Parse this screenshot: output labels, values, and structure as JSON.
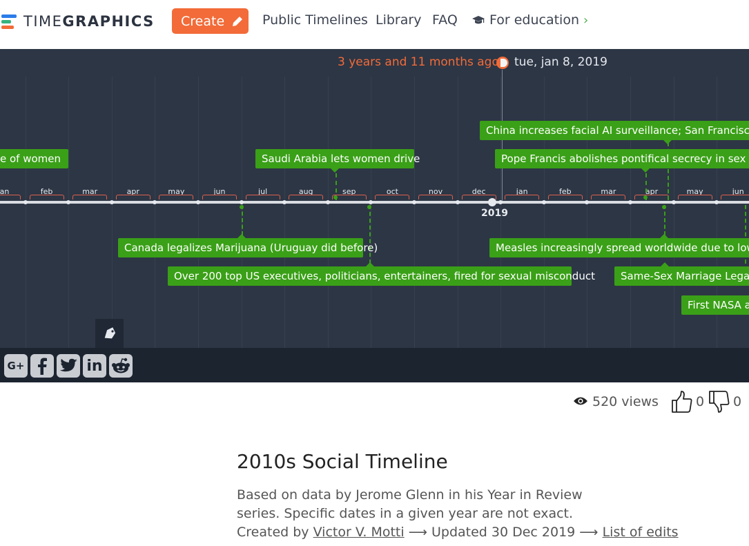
{
  "colors": {
    "timeline_bg": "#2d3645",
    "grid_line": "#36404f",
    "share_bar_bg": "#1c2430",
    "event_green": "#3aa017",
    "accent_orange": "#f26b38",
    "bracket_red": "#e0604a",
    "share_icon_bg": "#c9cdd2"
  },
  "header": {
    "logo": {
      "part1": "TIME",
      "part2": "GRAPHICS"
    },
    "create_label": "Create",
    "nav": {
      "public_timelines": "Public Timelines",
      "library": "Library",
      "faq": "FAQ",
      "for_education": "For education"
    }
  },
  "timeline": {
    "time_ago": "3 years and 11 months ago",
    "current_date": "tue, jan 8, 2019",
    "year_label": "2019",
    "months": [
      "jan",
      "feb",
      "mar",
      "apr",
      "may",
      "jun",
      "jul",
      "aug",
      "sep",
      "oct",
      "nov",
      "dec",
      "jan",
      "feb",
      "mar",
      "apr",
      "may",
      "jun"
    ],
    "events_above": [
      {
        "label": "e of women"
      },
      {
        "label": "Saudi Arabia lets women drive"
      },
      {
        "label": "China increases facial AI surveillance; San Francisco ban"
      },
      {
        "label": "Pope Francis abolishes pontifical secrecy in sex abus"
      }
    ],
    "events_below": [
      {
        "label": "Canada legalizes Marijuana (Uruguay did before)"
      },
      {
        "label": "Over 200 top US executives, politicians, entertainers,  fired for sexual misconduct"
      },
      {
        "label": "Measles increasingly spread worldwide due to lower v"
      },
      {
        "label": "Same-Sex Marriage Legaliz"
      },
      {
        "label": "First NASA all"
      }
    ]
  },
  "share": {
    "icons": [
      "google-plus-icon",
      "facebook-icon",
      "twitter-icon",
      "linkedin-icon",
      "reddit-icon"
    ],
    "g_plus_text": "G+",
    "linkedin_text": "in"
  },
  "stats": {
    "views": "520 views",
    "likes": "0",
    "dislikes": "0"
  },
  "info": {
    "title": "2010s Social Timeline",
    "description_line1": "Based on data by Jerome Glenn in his Year in Review",
    "description_line2": "series. Specific dates in a given year are not exact.",
    "created_by_prefix": "Created by",
    "author": "Victor V. Motti",
    "updated": "⟶ Updated 30 Dec 2019 ⟶",
    "list_of_edits": "List of edits"
  }
}
